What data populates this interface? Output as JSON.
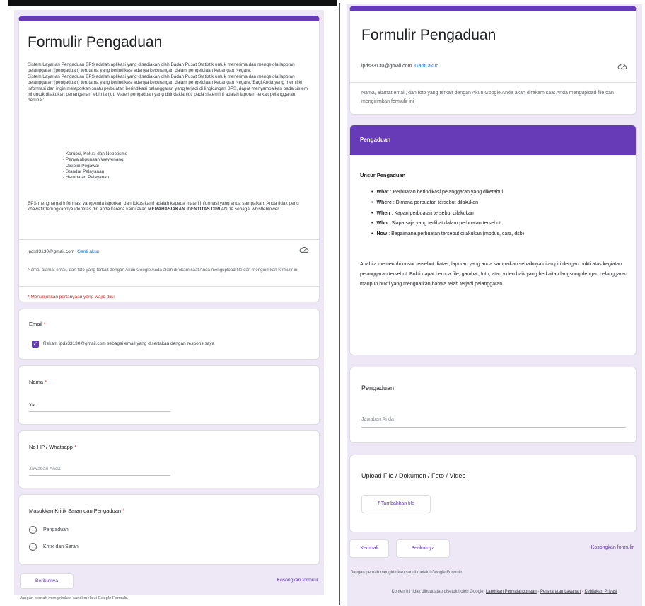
{
  "left": {
    "title": "Formulir Pengaduan",
    "desc": [
      "Sistem Layanan Pengaduan BPS adalah aplikasi yang disediakan oleh Badan Pusat Statistik untuk menerima dan mengelola laporan pelanggaran (pengaduan) terutama yang berindikasi adanya kecurangan dalam pengelolaan keuangan Negara.",
      "Sistem Layanan Pengaduan BPS adalah aplikasi yang disediakan oleh Badan Pusat Statistik untuk menerima dan mengelola laporan pelanggaran (pengaduan) terutama yang berindikasi adanya kecurangan dalam pengelolaan keuangan Negara. Bagi Anda yang memiliki informasi dan ingin melaporkan suatu perbuatan berindikasi pelanggaran yang terjadi di lingkungan BPS, dapat menyampaikan pada sistem ini untuk dilakukan penanganan lebih lanjut. Materi pengaduan yang ditindaklanjuti pada sistem ini adalah laporan terkait pelanggaran berupa :"
    ],
    "bullets": [
      "Korupsi, Kolusi dan Nepotisme",
      "Penyalahgunaan Wewenang",
      "Disiplin Pegawai",
      "Standar Pelayanan",
      "Hambatan Pelayanan"
    ],
    "desc2_a": "BPS menghargai informasi yang Anda laporkan dan fokus kami adalah kepada materi informasi yang anda sampaikan. Anda tidak perlu khawatir terungkapnya identitas diri anda karena kami akan ",
    "desc2_b": "MERAHASIAKAN IDENTITAS DIRI",
    "desc2_c": " ANDA sebagai whistleblower",
    "account_email": "ipds33130@gmail.com",
    "switch_account": "Ganti akun",
    "account_note": "Nama, alamat email, dan foto yang terkait dengan Akun Google Anda akan direkam saat Anda mengupload file dan mengirimkan formulir ini",
    "required_note": "* Menunjukkan pertanyaan yang wajib diisi",
    "email_label": "Email",
    "email_checkbox": "Rekam ipds33130@gmail.com sebagai email yang disertakan dengan respons saya",
    "nama_label": "Nama",
    "nama_value": "Ya",
    "hp_label": "No HP / Whatsapp",
    "hp_placeholder": "Jawaban Anda",
    "kritik_label": "Masukkan Kritik Saran dan Pengaduan",
    "options": [
      "Pengaduan",
      "Kritik dan Saran"
    ],
    "next_button": "Berikutnya",
    "clear_button": "Kosongkan formulir",
    "footer": "Jangan pernah mengirimkan sandi melalui Google Formulir."
  },
  "right": {
    "title": "Formulir Pengaduan",
    "account_email": "ipds33130@gmail.com",
    "switch_account": "Ganti akun",
    "account_note": "Nama, alamat email, dan foto yang terkait dengan Akun Google Anda akan direkam saat Anda mengupload file dan mengirimkan formulir ini",
    "section_title": "Pengaduan",
    "section_sub": "Unsur Pengaduan",
    "unsur": [
      {
        "key": "What",
        "text": ": Perbuatan berindikasi pelanggaran yang diketahui"
      },
      {
        "key": "Where",
        "text": ": Dimana perbuatan tersebut dilakukan"
      },
      {
        "key": "When",
        "text": ": Kapan perbuatan tersebut dilakukan"
      },
      {
        "key": "Who",
        "text": ": Siapa saja yang terlibat dalam perbuatan tersebut"
      },
      {
        "key": "How",
        "text": ": Bagaimana perbuatan tersebut dilakukan (modus, cara, dsb)"
      }
    ],
    "section_para": "Apabila memenuhi unsur tersebut diatas, laporan yang anda sampaikan sebaiknya dilampiri dengan bukti atas kegiatan pelanggaran tersebut. Bukti dapat berupa file, gambar, foto, atau video baik yang berkaitan langsung dengan pelanggaran maupun bukti yang menguatkan bahwa telah terjadi pelanggaran.",
    "pengaduan_label": "Pengaduan",
    "pengaduan_placeholder": "Jawaban Anda",
    "upload_label": "Upload File / Dokumen / Foto / Video",
    "add_file": "Tambahkan file",
    "back_button": "Kembali",
    "next_button": "Berikutnya",
    "clear_button": "Kosongkan formulir",
    "footer1": "Jangan pernah mengirimkan sandi melalui Google Formulir.",
    "footer2_text": "Konten ini tidak dibuat atau disetujui oleh Google.",
    "footer2_link1": "Laporkan Penyalahgunaan",
    "footer2_link2": "Persyaratan Layanan",
    "footer2_link3": "Kebijakan Privasi"
  },
  "colors": {
    "accent": "#673ab7",
    "background": "#ede7f6",
    "required": "#d93025",
    "link": "#1a73e8"
  }
}
